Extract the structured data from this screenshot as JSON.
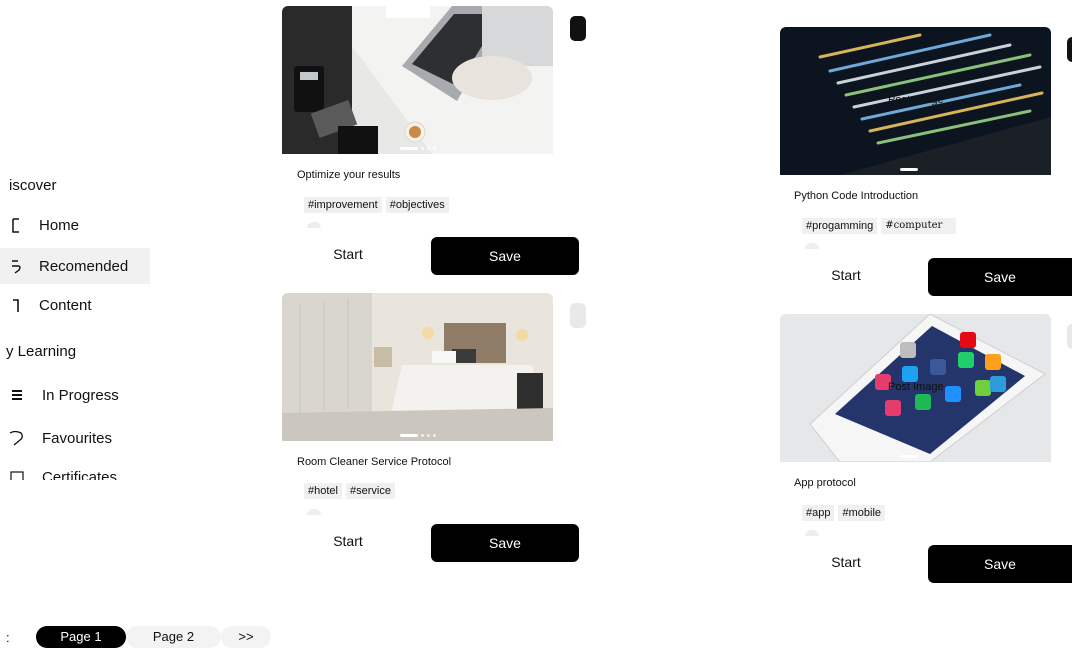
{
  "sidebar": {
    "discover_heading": "iscover",
    "discover_items": [
      {
        "label": "Home",
        "icon": "home-icon"
      },
      {
        "label": "Recomended",
        "icon": "thumbs-up-icon"
      },
      {
        "label": "Content",
        "icon": "document-icon"
      }
    ],
    "learning_heading": "y Learning",
    "learning_items": [
      {
        "label": "In Progress",
        "icon": "list-icon"
      },
      {
        "label": "Favourites",
        "icon": "heart-icon"
      },
      {
        "label": "Certificates",
        "icon": "certificate-icon"
      }
    ]
  },
  "pagination": {
    "prev": ":",
    "pages": [
      "Page 1",
      "Page 2"
    ],
    "next": ">>",
    "current": "Page 1"
  },
  "cards": [
    {
      "title": "Optimize your results",
      "tags": [
        "#improvement",
        "#objectives"
      ],
      "image_label": "",
      "start_label": "Start",
      "save_label": "Save"
    },
    {
      "title": "Room Cleaner Service Protocol",
      "tags": [
        "#hotel",
        "#service"
      ],
      "image_label": "",
      "start_label": "Start",
      "save_label": "Save"
    },
    {
      "title": "Python Code Introduction",
      "tags": [
        "#progamming",
        "#computer"
      ],
      "image_label": "Post Image",
      "start_label": "Start",
      "save_label": "Save"
    },
    {
      "title": "App protocol",
      "tags": [
        "#app",
        "#mobile"
      ],
      "image_label": "Post Image",
      "start_label": "Start",
      "save_label": "Save"
    }
  ],
  "colors": {
    "accent": "#000000",
    "active_bg": "#f1f1f1",
    "tag_bg": "#f0f0f0"
  }
}
